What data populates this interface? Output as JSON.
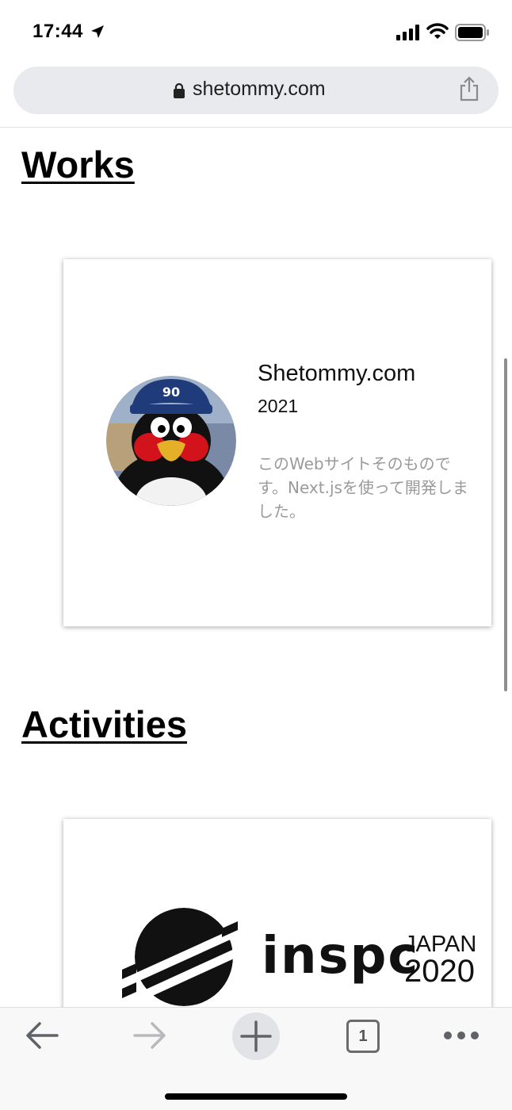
{
  "status_bar": {
    "time": "17:44",
    "icons": [
      "location-arrow-icon",
      "signal-icon",
      "wifi-icon",
      "battery-icon"
    ]
  },
  "browser": {
    "url": "shetommy.com",
    "icons": [
      "lock-icon",
      "share-icon"
    ]
  },
  "sections": {
    "works": {
      "heading": "Works",
      "card": {
        "title": "Shetommy.com",
        "year": "2021",
        "description": "このWebサイトそのものです。Next.jsを使って開発しました。",
        "image": "penguin-mascot-avatar"
      }
    },
    "activities": {
      "heading": "Activities",
      "card": {
        "logo_text": "inspc",
        "logo_sub1": "JAPAN",
        "logo_sub2": "2020"
      }
    }
  },
  "toolbar": {
    "tab_count": "1",
    "icons": [
      "back-arrow-icon",
      "forward-arrow-icon",
      "plus-icon",
      "tabs-icon",
      "more-icon"
    ]
  },
  "colors": {
    "url_bar_bg": "#e9eaee",
    "description_text": "#9a9a9a",
    "toolbar_bg": "#f8f8f9",
    "new_tab_bg": "#e2e3e6"
  }
}
